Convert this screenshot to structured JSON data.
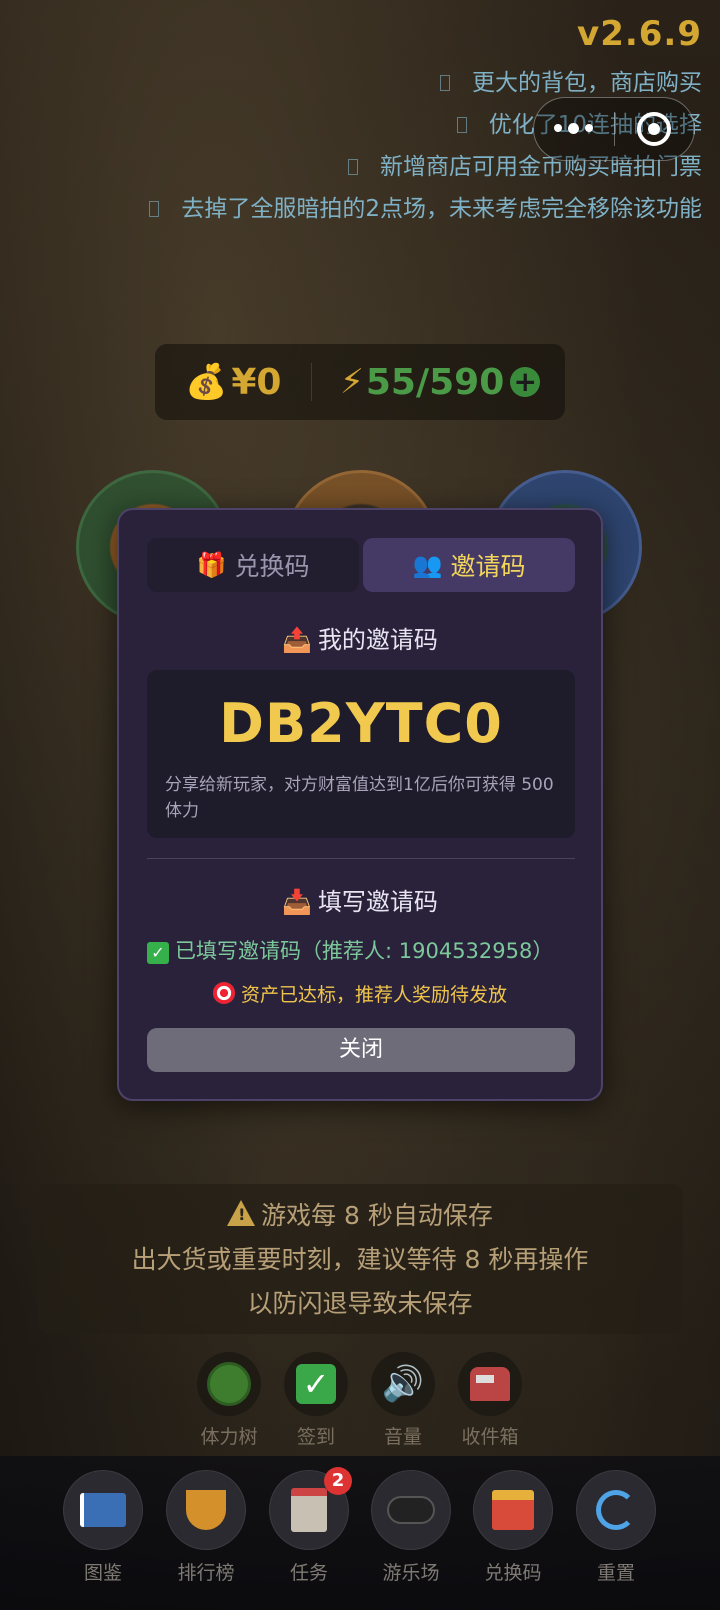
{
  "version": "v2.6.9",
  "changelog": [
    "更大的背包，商店购买",
    "优化了10连抽的选择",
    "新增商店可用金币购买暗拍门票",
    "去掉了全服暗拍的2点场，未来考虑完全移除该功能"
  ],
  "currency": {
    "money": "¥0",
    "money_icon": "money-bag-icon",
    "energy": "55/590",
    "energy_icon": "lightning-icon",
    "add_icon": "plus-icon"
  },
  "modal": {
    "tabs": [
      {
        "label": "兑换码",
        "icon": "gift-icon",
        "active": false
      },
      {
        "label": "邀请码",
        "icon": "users-icon",
        "active": true
      }
    ],
    "my_code_title": "我的邀请码",
    "my_code": "DB2YTC0",
    "my_code_desc": "分享给新玩家，对方财富值达到1亿后你可获得 500 体力",
    "fill_title": "填写邀请码",
    "filled_status": "已填写邀请码（推荐人: 1904532958）",
    "reward_status": "资产已达标，推荐人奖励待发放",
    "close_label": "关闭"
  },
  "notice": {
    "line1": "游戏每 8 秒自动保存",
    "line2": "出大货或重要时刻，建议等待 8 秒再操作",
    "line3": "以防闪退导致未保存"
  },
  "quick_actions": [
    {
      "label": "体力树",
      "icon": "tree-icon"
    },
    {
      "label": "签到",
      "icon": "checkmark-icon"
    },
    {
      "label": "音量",
      "icon": "speaker-icon"
    },
    {
      "label": "收件箱",
      "icon": "mailbox-icon"
    }
  ],
  "bottom_nav": [
    {
      "label": "图鉴",
      "icon": "book-icon"
    },
    {
      "label": "排行榜",
      "icon": "trophy-icon"
    },
    {
      "label": "任务",
      "icon": "clipboard-icon",
      "badge": "2"
    },
    {
      "label": "游乐场",
      "icon": "gamepad-icon"
    },
    {
      "label": "兑换码",
      "icon": "gift-icon"
    },
    {
      "label": "重置",
      "icon": "refresh-icon"
    }
  ],
  "colors": {
    "gold": "#d4a733",
    "green": "#4b9a48",
    "changelog_blue": "#7fb1c6",
    "modal_bg": "#29223a",
    "active_tab_text": "#f2d55a"
  }
}
